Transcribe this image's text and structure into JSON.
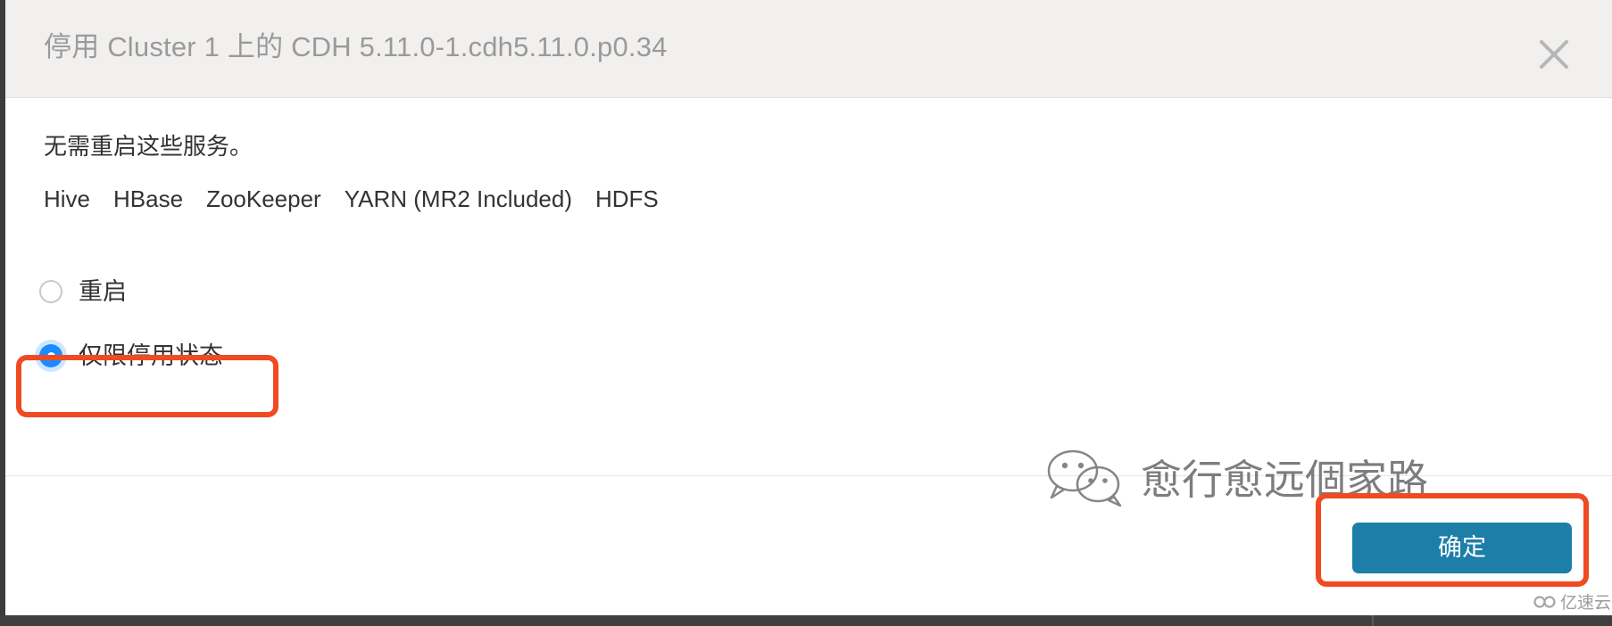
{
  "dialog": {
    "title": "停用 Cluster 1 上的 CDH 5.11.0-1.cdh5.11.0.p0.34",
    "close_icon": "close-icon",
    "body": {
      "note": "无需重启这些服务。",
      "services": [
        "Hive",
        "HBase",
        "ZooKeeper",
        "YARN (MR2 Included)",
        "HDFS"
      ],
      "radio_options": [
        {
          "label": "重启",
          "checked": false
        },
        {
          "label": "仅限停用状态",
          "checked": true
        }
      ]
    },
    "footer": {
      "confirm_label": "确定"
    }
  },
  "annotations": {
    "color": "#f04a23",
    "radio_highlight": "仅限停用状态",
    "button_highlight": "确定"
  },
  "watermarks": {
    "wechat_icon": "wechat-icon",
    "wechat_text": "愈行愈远個家路",
    "brand_icon": "cloud-logo-icon",
    "brand_text": "亿速云"
  },
  "colors": {
    "header_bg": "#f1f0ef",
    "title_text": "#9a9a9a",
    "body_text": "#333333",
    "radio_checked": "#1a8cff",
    "primary_button": "#1d7ea8",
    "annotation": "#f04a23"
  }
}
